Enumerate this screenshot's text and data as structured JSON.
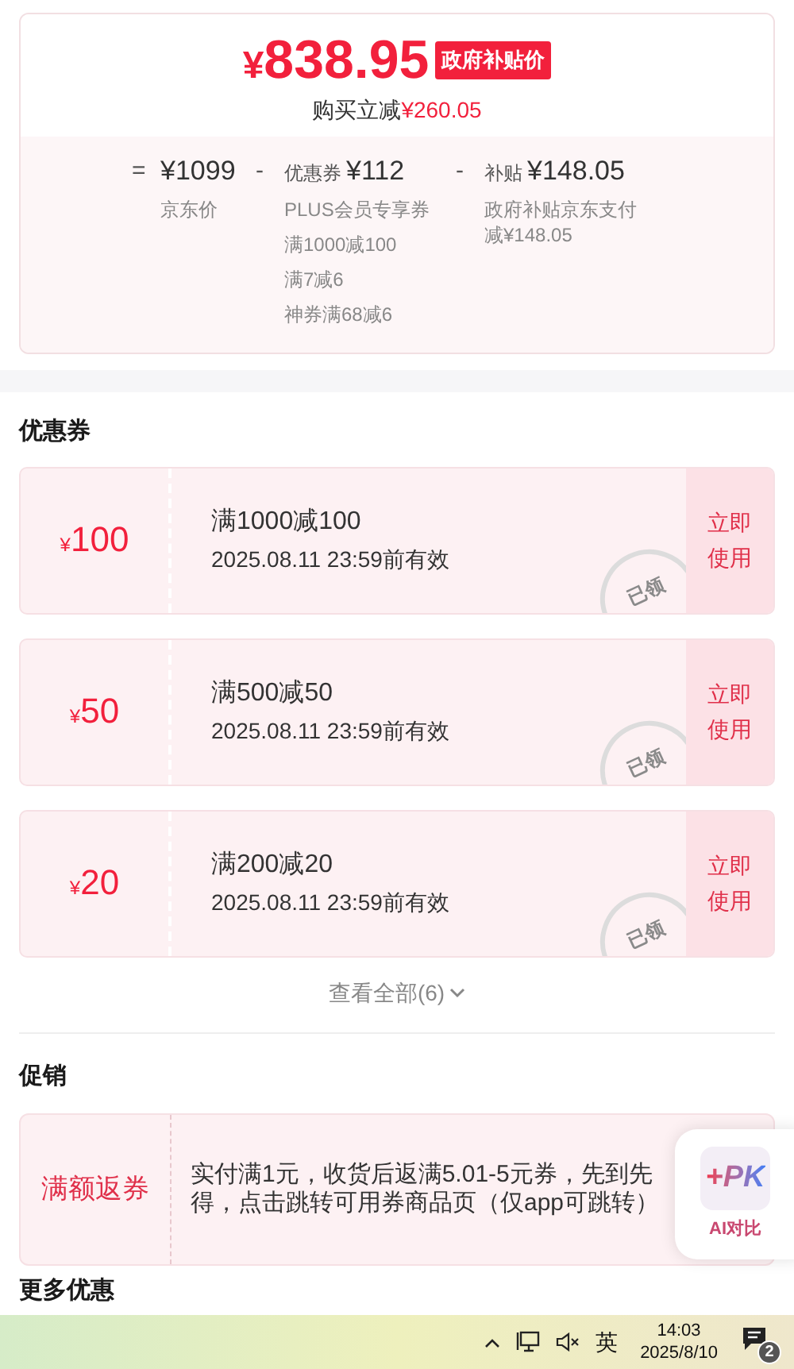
{
  "price": {
    "symbol": "¥",
    "amount": "838.95",
    "badge": "政府补贴价",
    "saving_label": "购买立减",
    "saving": "¥260.05"
  },
  "breakdown": [
    {
      "op": "=",
      "value": "¥1099",
      "notes": [
        "京东价"
      ]
    },
    {
      "op": "-",
      "label": "优惠券",
      "value": "¥112",
      "notes": [
        "PLUS会员专享券",
        "满1000减100",
        "满7减6",
        "神券满68减6"
      ]
    },
    {
      "op": "-",
      "label": "补贴",
      "value": "¥148.05",
      "notes": [
        "政府补贴京东支付减¥148.05"
      ]
    }
  ],
  "coupons_section": {
    "title": "优惠券",
    "view_all": "查看全部(6)"
  },
  "coupons": [
    {
      "symbol": "¥",
      "amount": "100",
      "condition": "满1000减100",
      "validity": "2025.08.11 23:59前有效",
      "action": "立即使用",
      "stamp": "已领"
    },
    {
      "symbol": "¥",
      "amount": "50",
      "condition": "满500减50",
      "validity": "2025.08.11 23:59前有效",
      "action": "立即使用",
      "stamp": "已领"
    },
    {
      "symbol": "¥",
      "amount": "20",
      "condition": "满200减20",
      "validity": "2025.08.11 23:59前有效",
      "action": "立即使用",
      "stamp": "已领"
    }
  ],
  "promotions": {
    "title": "促销",
    "items": [
      {
        "tag": "满额返券",
        "text": "实付满1元，收货后返满5.01-5元券，先到先得，点击跳转可用券商品页（仅app可跳转）"
      }
    ]
  },
  "more_offers": {
    "title": "更多优惠"
  },
  "ai_widget": {
    "logo": "+PK",
    "label": "AI对比"
  },
  "taskbar": {
    "ime": "英",
    "time": "14:03",
    "date": "2025/8/10",
    "notifications": "2"
  }
}
